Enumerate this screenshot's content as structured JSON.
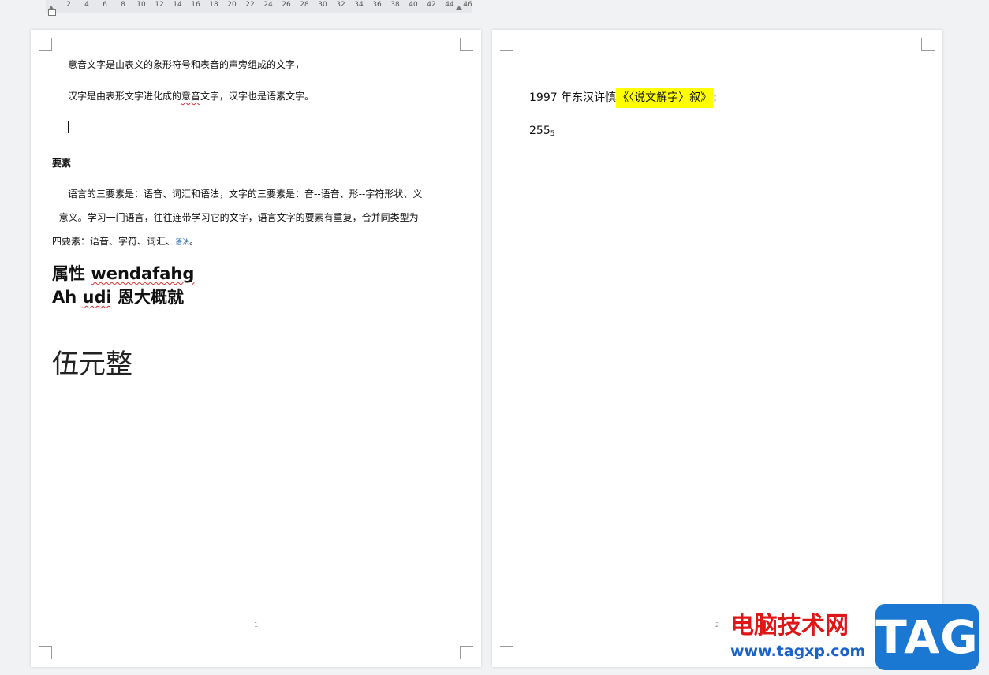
{
  "ruler": {
    "numbers": [
      "2",
      "4",
      "6",
      "8",
      "10",
      "12",
      "14",
      "16",
      "18",
      "20",
      "22",
      "24",
      "26",
      "28",
      "30",
      "32",
      "34",
      "36",
      "38",
      "40",
      "42",
      "44",
      "46"
    ]
  },
  "page1": {
    "line1": "意音文字是由表义的象形符号和表音的声旁组成的文字，",
    "line2_a": "汉字是由表形文字进化成的",
    "line2_b": "意音",
    "line2_c": "文字，汉字也是语素文字。",
    "section_heading": "要素",
    "para1": "语言的三要素是：语音、词汇和语法，文字的三要素是：音--语音、形--字符形状、义",
    "para2": "--意义。学习一门语言，往往连带学习它的文字，语言文字的要素有重复，合并同类型为",
    "para3_a": "四要素：语音、字符、词汇、",
    "para3_b": "语法",
    "para3_c": "。",
    "attr_a": "属性 ",
    "attr_b": "wendafahg",
    "ah_a": "Ah ",
    "ah_b": "udi",
    "ah_c": " 恩大概就",
    "big_text": "伍元整",
    "page_number": "1"
  },
  "page2": {
    "line1_a": "1997 年东汉许慎",
    "line1_b": "《〈说文解字〉叙》",
    "line1_c": ":",
    "line2_main": "255",
    "line2_sub": "5",
    "page_number": "2"
  },
  "watermark": {
    "site_name": "电脑技术网",
    "url": "www.tagxp.com",
    "logo_text": "TAG"
  },
  "colors": {
    "highlight": "#ffff00",
    "spell_error": "#e03030",
    "watermark_red": "#e01515",
    "watermark_blue": "#1a63c8",
    "logo_blue": "#1a78d2"
  }
}
